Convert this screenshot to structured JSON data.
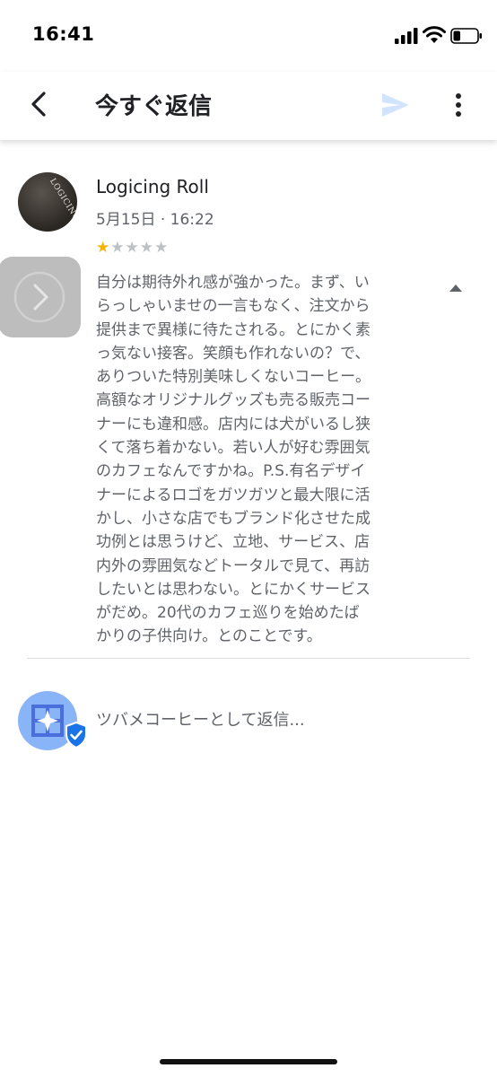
{
  "status_bar": {
    "time": "16:41",
    "battery_level": 0.3
  },
  "header": {
    "title": "今すぐ返信",
    "icons": [
      "back-arrow-icon",
      "send-icon",
      "more-vert-icon"
    ],
    "send_color": "#d2e3fc"
  },
  "review": {
    "reviewer_name": "Logicing Roll",
    "date": "5月15日 · 16:22",
    "rating": 1,
    "rating_max": 5,
    "avatar_text": "LOGICING · ORIGINAL TR",
    "text": "自分は期待外れ感が強かった。まず、い\nらっしゃいませの一言もなく、注文から\n提供まで異様に待たされる。とにかく素\nっ気ない接客。笑顔も作れないの？で、\nありついた特別美味しくないコーヒー。\n高額なオリジナルグッズも売る販売コー\nナーにも違和感。店内には犬がいるし狭\nくて落ち着かない。若い人が好む雰囲気\nのカフェなんですかね。P.S.有名デザイ\nナーによるロゴをガツガツと最大限に活\nかし、小さな店でもブランド化させた成\n功例とは思うけど、立地、サービス、店\n内外の雰囲気などトータルで見て、再訪\nしたいとは思わない。とにかくサービス\nがだめ。20代のカフェ巡りを始めたば\nかりの子供向け。とのことです。"
  },
  "reply": {
    "placeholder": "ツバメコーヒーとして返信...",
    "value": ""
  },
  "colors": {
    "star_filled": "#f4b400",
    "star_empty": "#bdc1c6",
    "reply_avatar_bg": "#8ab4f8",
    "verified_badge": "#1a73e8"
  }
}
